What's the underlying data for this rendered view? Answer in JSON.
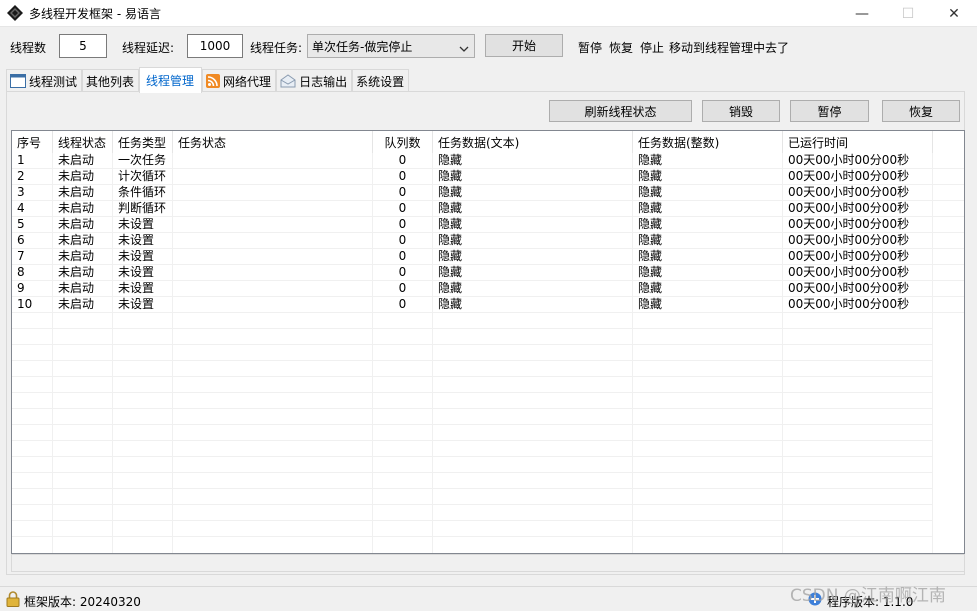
{
  "window": {
    "title": "多线程开发框架 - 易语言",
    "minimize": "—",
    "maximize": "☐",
    "close": "✕"
  },
  "controls": {
    "thread_count_label": "线程数",
    "thread_count_value": "5",
    "thread_delay_label": "线程延迟:",
    "thread_delay_value": "1000",
    "thread_task_label": "线程任务:",
    "thread_task_selected": "单次任务-做完停止",
    "start_button": "开始",
    "pause_link": "暂停",
    "resume_link": "恢复",
    "stop_link": "停止",
    "hint_text": "移动到线程管理中去了"
  },
  "tabs": [
    {
      "label": "线程测试",
      "active": false,
      "icon": "window-icon"
    },
    {
      "label": "其他列表",
      "active": false,
      "icon": ""
    },
    {
      "label": "线程管理",
      "active": true,
      "icon": ""
    },
    {
      "label": "网络代理",
      "active": false,
      "icon": "rss-icon"
    },
    {
      "label": "日志输出",
      "active": false,
      "icon": "envelope-icon"
    },
    {
      "label": "系统设置",
      "active": false,
      "icon": ""
    }
  ],
  "panel": {
    "refresh_button": "刷新线程状态",
    "destroy_button": "销毁",
    "pause_button": "暂停",
    "resume_button": "恢复"
  },
  "table": {
    "columns": [
      "序号",
      "线程状态",
      "任务类型",
      "任务状态",
      "队列数",
      "任务数据(文本)",
      "任务数据(整数)",
      "已运行时间"
    ],
    "rows": [
      [
        "1",
        "未启动",
        "一次任务",
        "",
        "0",
        "隐藏",
        "隐藏",
        "00天00小时00分00秒"
      ],
      [
        "2",
        "未启动",
        "计次循环",
        "",
        "0",
        "隐藏",
        "隐藏",
        "00天00小时00分00秒"
      ],
      [
        "3",
        "未启动",
        "条件循环",
        "",
        "0",
        "隐藏",
        "隐藏",
        "00天00小时00分00秒"
      ],
      [
        "4",
        "未启动",
        "判断循环",
        "",
        "0",
        "隐藏",
        "隐藏",
        "00天00小时00分00秒"
      ],
      [
        "5",
        "未启动",
        "未设置",
        "",
        "0",
        "隐藏",
        "隐藏",
        "00天00小时00分00秒"
      ],
      [
        "6",
        "未启动",
        "未设置",
        "",
        "0",
        "隐藏",
        "隐藏",
        "00天00小时00分00秒"
      ],
      [
        "7",
        "未启动",
        "未设置",
        "",
        "0",
        "隐藏",
        "隐藏",
        "00天00小时00分00秒"
      ],
      [
        "8",
        "未启动",
        "未设置",
        "",
        "0",
        "隐藏",
        "隐藏",
        "00天00小时00分00秒"
      ],
      [
        "9",
        "未启动",
        "未设置",
        "",
        "0",
        "隐藏",
        "隐藏",
        "00天00小时00分00秒"
      ],
      [
        "10",
        "未启动",
        "未设置",
        "",
        "0",
        "隐藏",
        "隐藏",
        "00天00小时00分00秒"
      ]
    ]
  },
  "status": {
    "framework_version": "框架版本: 20240320",
    "program_version": "程序版本: 1.1.0",
    "watermark": "CSDN @江南啊江南"
  },
  "colors": {
    "active_tab_text": "#0066cc",
    "window_bg": "#f0f0f0"
  }
}
